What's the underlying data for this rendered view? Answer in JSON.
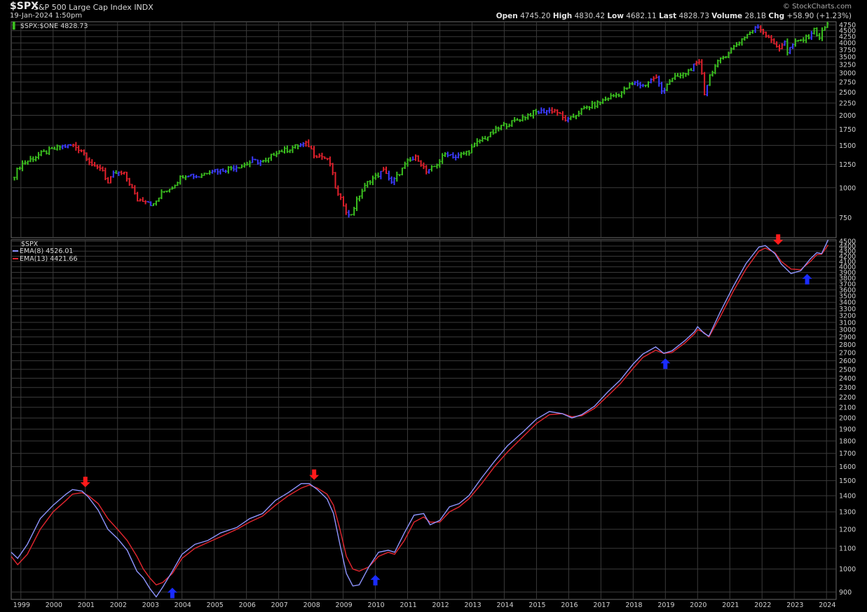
{
  "header": {
    "ticker": "$SPX",
    "name": "S&P 500 Large Cap Index",
    "exchange": "INDX",
    "date": "19-Jan-2024 1:50pm",
    "brand": "© StockCharts.com",
    "stats": [
      {
        "label": "Open",
        "value": "4745.20"
      },
      {
        "label": "High",
        "value": "4830.42"
      },
      {
        "label": "Low",
        "value": "4682.11"
      },
      {
        "label": "Last",
        "value": "4828.73"
      },
      {
        "label": "Volume",
        "value": "28.1B"
      },
      {
        "label": "Chg",
        "value": "+58.90 (+1.23%)"
      }
    ]
  },
  "colors": {
    "up": "#3bbf1f",
    "down": "#e0202c",
    "neutral": "#3b3bff",
    "ema_fast": "#8f95ff",
    "ema_slow": "#e4262f",
    "arrow_up": "#1a2cff",
    "arrow_down": "#ff1a1a",
    "grid": "#3a3a3a"
  },
  "chart_data": [
    {
      "type": "ohlc",
      "legend": [
        {
          "name": "$SPX:$ONE",
          "value": "4828.73"
        }
      ],
      "scale": "log",
      "ylim": [
        620,
        4900
      ],
      "yticks": [
        750,
        1000,
        1250,
        1500,
        1750,
        2000,
        2250,
        2500,
        2750,
        3000,
        3250,
        3500,
        3750,
        4000,
        4250,
        4500,
        4750
      ],
      "x_tick_labels": [
        "1999",
        "2000",
        "2001",
        "2002",
        "2003",
        "2004",
        "2005",
        "2006",
        "2007",
        "2008",
        "2009",
        "2010",
        "2011",
        "2012",
        "2013",
        "2014",
        "2015",
        "2016",
        "2017",
        "2018",
        "2019",
        "2020",
        "2021",
        "2022",
        "2023",
        "2024"
      ],
      "x_range": [
        1998.7,
        2024.3
      ],
      "grid": true,
      "bar_colors": "green = rising, red = falling, blue = neutral",
      "close_path": [
        [
          1998.8,
          1130
        ],
        [
          1999.0,
          1250
        ],
        [
          1999.3,
          1310
        ],
        [
          1999.6,
          1380
        ],
        [
          2000.0,
          1440
        ],
        [
          2000.2,
          1480
        ],
        [
          2000.6,
          1500
        ],
        [
          2000.9,
          1430
        ],
        [
          2001.1,
          1310
        ],
        [
          2001.3,
          1200
        ],
        [
          2001.5,
          1220
        ],
        [
          2001.7,
          1040
        ],
        [
          2001.9,
          1150
        ],
        [
          2002.2,
          1140
        ],
        [
          2002.4,
          1030
        ],
        [
          2002.6,
          890
        ],
        [
          2002.9,
          890
        ],
        [
          2003.1,
          840
        ],
        [
          2003.4,
          960
        ],
        [
          2003.7,
          1010
        ],
        [
          2004.0,
          1120
        ],
        [
          2004.2,
          1140
        ],
        [
          2004.5,
          1110
        ],
        [
          2004.9,
          1190
        ],
        [
          2005.2,
          1180
        ],
        [
          2005.5,
          1210
        ],
        [
          2005.9,
          1240
        ],
        [
          2006.2,
          1290
        ],
        [
          2006.6,
          1280
        ],
        [
          2006.9,
          1410
        ],
        [
          2007.2,
          1430
        ],
        [
          2007.6,
          1500
        ],
        [
          2007.9,
          1520
        ],
        [
          2008.1,
          1380
        ],
        [
          2008.4,
          1340
        ],
        [
          2008.6,
          1260
        ],
        [
          2008.8,
          950
        ],
        [
          2009.0,
          860
        ],
        [
          2009.2,
          750
        ],
        [
          2009.5,
          930
        ],
        [
          2009.8,
          1070
        ],
        [
          2010.0,
          1110
        ],
        [
          2010.3,
          1190
        ],
        [
          2010.5,
          1040
        ],
        [
          2010.8,
          1180
        ],
        [
          2011.0,
          1280
        ],
        [
          2011.3,
          1340
        ],
        [
          2011.6,
          1150
        ],
        [
          2011.9,
          1250
        ],
        [
          2012.2,
          1400
        ],
        [
          2012.5,
          1340
        ],
        [
          2012.9,
          1420
        ],
        [
          2013.2,
          1560
        ],
        [
          2013.5,
          1640
        ],
        [
          2013.9,
          1800
        ],
        [
          2014.2,
          1860
        ],
        [
          2014.6,
          1970
        ],
        [
          2014.9,
          2050
        ],
        [
          2015.3,
          2090
        ],
        [
          2015.6,
          2100
        ],
        [
          2015.8,
          1950
        ],
        [
          2016.0,
          1900
        ],
        [
          2016.3,
          2060
        ],
        [
          2016.6,
          2170
        ],
        [
          2016.9,
          2240
        ],
        [
          2017.2,
          2360
        ],
        [
          2017.6,
          2470
        ],
        [
          2017.9,
          2670
        ],
        [
          2018.1,
          2730
        ],
        [
          2018.3,
          2650
        ],
        [
          2018.7,
          2900
        ],
        [
          2018.9,
          2500
        ],
        [
          2019.1,
          2780
        ],
        [
          2019.4,
          2900
        ],
        [
          2019.6,
          2970
        ],
        [
          2019.9,
          3220
        ],
        [
          2020.1,
          3300
        ],
        [
          2020.2,
          2440
        ],
        [
          2020.4,
          2990
        ],
        [
          2020.6,
          3270
        ],
        [
          2020.9,
          3600
        ],
        [
          2021.2,
          3940
        ],
        [
          2021.5,
          4300
        ],
        [
          2021.9,
          4700
        ],
        [
          2022.0,
          4500
        ],
        [
          2022.3,
          4150
        ],
        [
          2022.5,
          3700
        ],
        [
          2022.7,
          4130
        ],
        [
          2022.8,
          3600
        ],
        [
          2022.9,
          3900
        ],
        [
          2023.1,
          4050
        ],
        [
          2023.4,
          4200
        ],
        [
          2023.6,
          4550
        ],
        [
          2023.8,
          4200
        ],
        [
          2023.9,
          4560
        ],
        [
          2024.05,
          4830
        ]
      ]
    },
    {
      "type": "line",
      "title": "$SPX",
      "series": [
        {
          "name": "EMA(8)",
          "value": "4526.01"
        },
        {
          "name": "EMA(13)",
          "value": "4421.66"
        }
      ],
      "scale": "log",
      "ylim": [
        870,
        4530
      ],
      "yticks": [
        900,
        1000,
        1100,
        1200,
        1300,
        1400,
        1500,
        1600,
        1700,
        1800,
        1900,
        2000,
        2100,
        2200,
        2300,
        2400,
        2500,
        2600,
        2700,
        2800,
        2900,
        3000,
        3100,
        3200,
        3300,
        3400,
        3500,
        3600,
        3700,
        3800,
        3900,
        4000,
        4100,
        4200,
        4300,
        4400,
        4500
      ],
      "x_range": [
        1998.7,
        2024.3
      ],
      "grid": true,
      "ema_fast": [
        [
          1998.7,
          1080
        ],
        [
          1998.9,
          1050
        ],
        [
          1999.2,
          1120
        ],
        [
          1999.6,
          1260
        ],
        [
          2000.0,
          1340
        ],
        [
          2000.4,
          1410
        ],
        [
          2000.6,
          1440
        ],
        [
          2000.9,
          1430
        ],
        [
          2001.1,
          1390
        ],
        [
          2001.4,
          1310
        ],
        [
          2001.7,
          1200
        ],
        [
          2002.0,
          1150
        ],
        [
          2002.3,
          1090
        ],
        [
          2002.6,
          990
        ],
        [
          2002.8,
          960
        ],
        [
          2003.0,
          915
        ],
        [
          2003.2,
          880
        ],
        [
          2003.4,
          920
        ],
        [
          2003.7,
          990
        ],
        [
          2004.0,
          1070
        ],
        [
          2004.4,
          1120
        ],
        [
          2004.8,
          1140
        ],
        [
          2005.2,
          1180
        ],
        [
          2005.7,
          1210
        ],
        [
          2006.1,
          1260
        ],
        [
          2006.5,
          1290
        ],
        [
          2006.9,
          1370
        ],
        [
          2007.3,
          1420
        ],
        [
          2007.7,
          1480
        ],
        [
          2007.95,
          1480
        ],
        [
          2008.2,
          1440
        ],
        [
          2008.5,
          1380
        ],
        [
          2008.7,
          1290
        ],
        [
          2008.9,
          1120
        ],
        [
          2009.1,
          980
        ],
        [
          2009.3,
          925
        ],
        [
          2009.5,
          930
        ],
        [
          2009.8,
          1010
        ],
        [
          2010.1,
          1080
        ],
        [
          2010.4,
          1090
        ],
        [
          2010.6,
          1080
        ],
        [
          2010.9,
          1180
        ],
        [
          2011.2,
          1280
        ],
        [
          2011.5,
          1290
        ],
        [
          2011.7,
          1225
        ],
        [
          2012.0,
          1250
        ],
        [
          2012.3,
          1330
        ],
        [
          2012.6,
          1350
        ],
        [
          2012.9,
          1400
        ],
        [
          2013.3,
          1520
        ],
        [
          2013.7,
          1640
        ],
        [
          2014.1,
          1760
        ],
        [
          2014.6,
          1880
        ],
        [
          2015.0,
          1990
        ],
        [
          2015.4,
          2060
        ],
        [
          2015.8,
          2040
        ],
        [
          2016.1,
          2000
        ],
        [
          2016.4,
          2030
        ],
        [
          2016.8,
          2110
        ],
        [
          2017.2,
          2250
        ],
        [
          2017.6,
          2380
        ],
        [
          2018.0,
          2560
        ],
        [
          2018.3,
          2680
        ],
        [
          2018.7,
          2770
        ],
        [
          2018.95,
          2690
        ],
        [
          2019.2,
          2720
        ],
        [
          2019.6,
          2850
        ],
        [
          2019.9,
          2970
        ],
        [
          2020.0,
          3040
        ],
        [
          2020.2,
          2950
        ],
        [
          2020.35,
          2910
        ],
        [
          2020.7,
          3250
        ],
        [
          2021.1,
          3650
        ],
        [
          2021.5,
          4060
        ],
        [
          2021.9,
          4380
        ],
        [
          2022.1,
          4410
        ],
        [
          2022.4,
          4250
        ],
        [
          2022.6,
          4050
        ],
        [
          2022.9,
          3880
        ],
        [
          2023.2,
          3930
        ],
        [
          2023.5,
          4150
        ],
        [
          2023.7,
          4270
        ],
        [
          2023.85,
          4250
        ],
        [
          2024.05,
          4526
        ]
      ],
      "ema_slow": [
        [
          1998.7,
          1060
        ],
        [
          1998.9,
          1020
        ],
        [
          1999.2,
          1070
        ],
        [
          1999.6,
          1200
        ],
        [
          2000.0,
          1300
        ],
        [
          2000.4,
          1370
        ],
        [
          2000.6,
          1410
        ],
        [
          2000.9,
          1420
        ],
        [
          2001.1,
          1400
        ],
        [
          2001.4,
          1350
        ],
        [
          2001.7,
          1260
        ],
        [
          2002.0,
          1200
        ],
        [
          2002.3,
          1140
        ],
        [
          2002.6,
          1060
        ],
        [
          2002.8,
          1000
        ],
        [
          2003.0,
          960
        ],
        [
          2003.2,
          930
        ],
        [
          2003.4,
          940
        ],
        [
          2003.7,
          980
        ],
        [
          2004.0,
          1050
        ],
        [
          2004.4,
          1100
        ],
        [
          2004.8,
          1130
        ],
        [
          2005.2,
          1160
        ],
        [
          2005.7,
          1200
        ],
        [
          2006.1,
          1240
        ],
        [
          2006.5,
          1275
        ],
        [
          2006.9,
          1340
        ],
        [
          2007.3,
          1400
        ],
        [
          2007.7,
          1450
        ],
        [
          2007.95,
          1470
        ],
        [
          2008.2,
          1450
        ],
        [
          2008.5,
          1410
        ],
        [
          2008.7,
          1340
        ],
        [
          2008.9,
          1200
        ],
        [
          2009.1,
          1060
        ],
        [
          2009.3,
          1000
        ],
        [
          2009.5,
          990
        ],
        [
          2009.8,
          1010
        ],
        [
          2010.1,
          1060
        ],
        [
          2010.4,
          1080
        ],
        [
          2010.6,
          1070
        ],
        [
          2010.9,
          1140
        ],
        [
          2011.2,
          1240
        ],
        [
          2011.5,
          1270
        ],
        [
          2011.7,
          1240
        ],
        [
          2012.0,
          1240
        ],
        [
          2012.3,
          1300
        ],
        [
          2012.6,
          1330
        ],
        [
          2012.9,
          1380
        ],
        [
          2013.3,
          1480
        ],
        [
          2013.7,
          1600
        ],
        [
          2014.1,
          1710
        ],
        [
          2014.6,
          1840
        ],
        [
          2015.0,
          1950
        ],
        [
          2015.4,
          2030
        ],
        [
          2015.8,
          2040
        ],
        [
          2016.1,
          2010
        ],
        [
          2016.4,
          2020
        ],
        [
          2016.8,
          2090
        ],
        [
          2017.2,
          2210
        ],
        [
          2017.6,
          2340
        ],
        [
          2018.0,
          2510
        ],
        [
          2018.3,
          2640
        ],
        [
          2018.7,
          2730
        ],
        [
          2018.95,
          2690
        ],
        [
          2019.2,
          2700
        ],
        [
          2019.6,
          2820
        ],
        [
          2019.9,
          2940
        ],
        [
          2020.0,
          3000
        ],
        [
          2020.2,
          2960
        ],
        [
          2020.35,
          2900
        ],
        [
          2020.7,
          3180
        ],
        [
          2021.1,
          3570
        ],
        [
          2021.5,
          3960
        ],
        [
          2021.9,
          4300
        ],
        [
          2022.1,
          4360
        ],
        [
          2022.4,
          4270
        ],
        [
          2022.6,
          4100
        ],
        [
          2022.9,
          3960
        ],
        [
          2023.2,
          3950
        ],
        [
          2023.5,
          4100
        ],
        [
          2023.7,
          4230
        ],
        [
          2023.85,
          4240
        ],
        [
          2024.05,
          4421.66
        ]
      ],
      "signals": [
        {
          "dir": "down",
          "x": 2001.0,
          "y": 1460
        },
        {
          "dir": "up",
          "x": 2003.7,
          "y": 915
        },
        {
          "dir": "down",
          "x": 2008.1,
          "y": 1510
        },
        {
          "dir": "up",
          "x": 2010.0,
          "y": 970
        },
        {
          "dir": "up",
          "x": 2019.0,
          "y": 2620
        },
        {
          "dir": "down",
          "x": 2022.5,
          "y": 4440
        },
        {
          "dir": "up",
          "x": 2023.4,
          "y": 3860
        }
      ]
    }
  ]
}
